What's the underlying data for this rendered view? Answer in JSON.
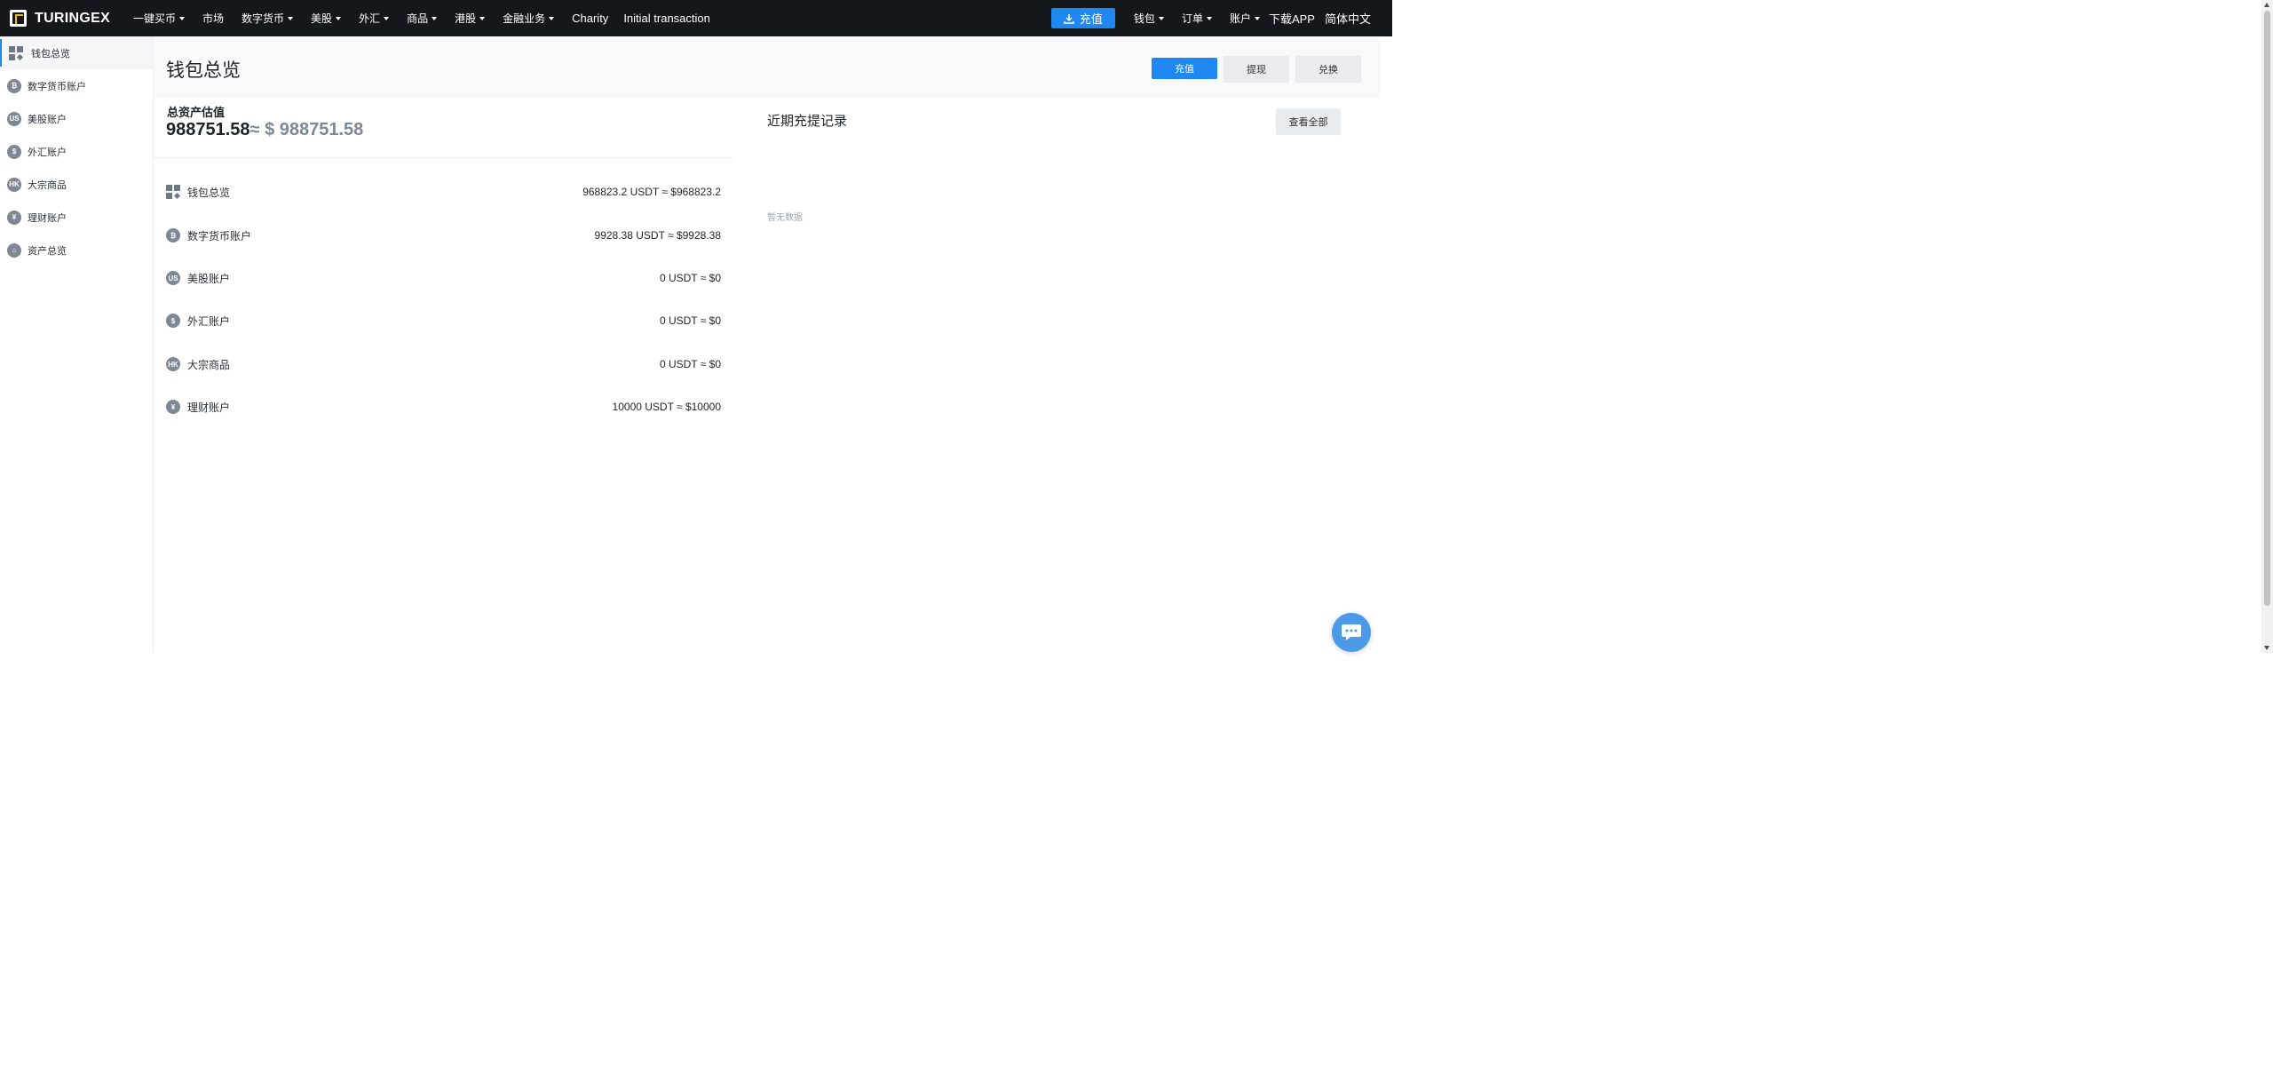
{
  "brand": {
    "name": "TURINGEX"
  },
  "nav": [
    {
      "label": "一键买币",
      "dropdown": true
    },
    {
      "label": "市场",
      "dropdown": false
    },
    {
      "label": "数字货币",
      "dropdown": true
    },
    {
      "label": "美股",
      "dropdown": true
    },
    {
      "label": "外汇",
      "dropdown": true
    },
    {
      "label": "商品",
      "dropdown": true
    },
    {
      "label": "港股",
      "dropdown": true
    },
    {
      "label": "金融业务",
      "dropdown": true
    },
    {
      "label": "Charity",
      "dropdown": false
    },
    {
      "label": "Initial transaction",
      "dropdown": false
    }
  ],
  "top_right": {
    "deposit": "充值",
    "wallet": "钱包",
    "orders": "订单",
    "account": "账户",
    "download": "下载APP",
    "language": "简体中文"
  },
  "sidebar": {
    "items": [
      {
        "label": "钱包总览",
        "icon": "grid-icon",
        "active": true
      },
      {
        "label": "数字货币账户",
        "icon": "bitcoin-icon",
        "badge": "₿"
      },
      {
        "label": "美股账户",
        "icon": "us-icon",
        "badge": "US"
      },
      {
        "label": "外汇账户",
        "icon": "forex-icon",
        "badge": "$"
      },
      {
        "label": "大宗商品",
        "icon": "hk-icon",
        "badge": "HK"
      },
      {
        "label": "理财账户",
        "icon": "finance-icon",
        "badge": "¥"
      },
      {
        "label": "资产总览",
        "icon": "assets-icon",
        "badge": "⌂"
      }
    ]
  },
  "header": {
    "title": "钱包总览",
    "deposit": "充值",
    "withdraw": "提现",
    "exchange": "兑换"
  },
  "summary": {
    "label": "总资产估值",
    "value": "988751.58",
    "approx": "≈ $ 988751.58"
  },
  "accounts": [
    {
      "label": "钱包总览",
      "icon": "grid-icon",
      "value": "968823.2 USDT ≈ $968823.2"
    },
    {
      "label": "数字货币账户",
      "icon": "bitcoin-icon",
      "badge": "₿",
      "value": "9928.38 USDT ≈ $9928.38"
    },
    {
      "label": "美股账户",
      "icon": "us-icon",
      "badge": "US",
      "value": "0 USDT ≈ $0"
    },
    {
      "label": "外汇账户",
      "icon": "forex-icon",
      "badge": "$",
      "value": "0 USDT ≈ $0"
    },
    {
      "label": "大宗商品",
      "icon": "hk-icon",
      "badge": "HK",
      "value": "0 USDT ≈ $0"
    },
    {
      "label": "理财账户",
      "icon": "finance-icon",
      "badge": "¥",
      "value": "10000 USDT ≈ $10000"
    }
  ],
  "records": {
    "title": "近期充提记录",
    "view_all": "查看全部",
    "empty": "暂无数据"
  },
  "colors": {
    "accent": "#1e88f0",
    "topbar": "#14171c",
    "logo_accent": "#f0b90b",
    "icon_grey": "#7e8794"
  }
}
